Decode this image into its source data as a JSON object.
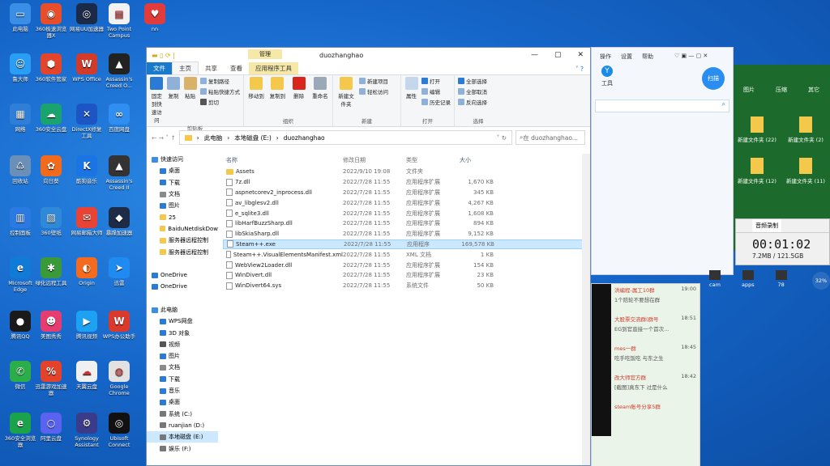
{
  "desktop": {
    "icons": [
      {
        "label": "此电脑",
        "color": "#3a8ee6",
        "glyph": "▭"
      },
      {
        "label": "360极速浏览器X",
        "color": "#e94e2b",
        "glyph": "◉"
      },
      {
        "label": "网易UU加速器",
        "color": "#1c2a4a",
        "glyph": "◎"
      },
      {
        "label": "Two Point Campus",
        "color": "#f2f2f2",
        "glyph": "▤"
      },
      {
        "label": "nn",
        "color": "#e23b3b",
        "glyph": "♥"
      },
      {
        "label": "鲁大师",
        "color": "#2a9df4",
        "glyph": "☺"
      },
      {
        "label": "360软件管家",
        "color": "#e2452b",
        "glyph": "⬢"
      },
      {
        "label": "WPS Office",
        "color": "#d23a2a",
        "glyph": "W"
      },
      {
        "label": "Assassin's Creed O...",
        "color": "#222",
        "glyph": "▲"
      },
      {
        "label": "网络",
        "color": "#2f7fd9",
        "glyph": "▦"
      },
      {
        "label": "360安全云盘",
        "color": "#1aa36f",
        "glyph": "☁"
      },
      {
        "label": "DirectX修复工具",
        "color": "#1d56c4",
        "glyph": "✕"
      },
      {
        "label": "百度网盘",
        "color": "#2f8ef0",
        "glyph": "∞"
      },
      {
        "label": "回收站",
        "color": "#6a8fb8",
        "glyph": "♺"
      },
      {
        "label": "向日葵",
        "color": "#f26a1b",
        "glyph": "✿"
      },
      {
        "label": "酷狗音乐",
        "color": "#1b74e4",
        "glyph": "K"
      },
      {
        "label": "Assassin's Creed II",
        "color": "#333",
        "glyph": "▲"
      },
      {
        "label": "控制面板",
        "color": "#2a7ae2",
        "glyph": "▥"
      },
      {
        "label": "360壁纸",
        "color": "#2f89d6",
        "glyph": "▧"
      },
      {
        "label": "网易邮箱大师",
        "color": "#e94335",
        "glyph": "✉"
      },
      {
        "label": "暴躁加速器",
        "color": "#1e2b46",
        "glyph": "◆"
      },
      {
        "label": "Microsoft Edge",
        "color": "#0f7bd6",
        "glyph": "e"
      },
      {
        "label": "绿化远程工具",
        "color": "#3a9a3a",
        "glyph": "✱"
      },
      {
        "label": "Origin",
        "color": "#f56b1d",
        "glyph": "◐"
      },
      {
        "label": "迅雷",
        "color": "#1f8af0",
        "glyph": "➤"
      },
      {
        "label": "腾讯QQ",
        "color": "#1a1a1a",
        "glyph": "●"
      },
      {
        "label": "美图秀秀",
        "color": "#e63d70",
        "glyph": "☻"
      },
      {
        "label": "腾讯视频",
        "color": "#1da1f2",
        "glyph": "▶"
      },
      {
        "label": "WPS办公助手",
        "color": "#d93a2b",
        "glyph": "W"
      },
      {
        "label": "微信",
        "color": "#2bae49",
        "glyph": "✆"
      },
      {
        "label": "迅雷游戏加速器",
        "color": "#e4432b",
        "glyph": "%"
      },
      {
        "label": "天翼云盘",
        "color": "#f0f0f0",
        "glyph": "☁"
      },
      {
        "label": "Google Chrome",
        "color": "#e2e2e2",
        "glyph": "◍"
      },
      {
        "label": "360安全浏览器",
        "color": "#1aa34a",
        "glyph": "e"
      },
      {
        "label": "阿里云盘",
        "color": "#5a63f0",
        "glyph": "○"
      },
      {
        "label": "Synology Assistant",
        "color": "#3b3b8c",
        "glyph": "⚙"
      },
      {
        "label": "Ubisoft Connect",
        "color": "#111",
        "glyph": "◎"
      }
    ]
  },
  "explorer": {
    "title": "duozhanghao",
    "manage_tab": "管理",
    "tabs": [
      "文件",
      "主页",
      "共享",
      "查看",
      "应用程序工具"
    ],
    "ribbon": {
      "pin": "固定到快速访问",
      "copy": "复制",
      "paste": "粘贴",
      "copy_path": "复制路径",
      "paste_shortcut": "粘贴快捷方式",
      "cut": "剪切",
      "clipboard": "剪贴板",
      "move_to": "移动到",
      "copy_to": "复制到",
      "delete": "删除",
      "rename": "重命名",
      "organize": "组织",
      "new_folder": "新建文件夹",
      "new_item": "新建项目",
      "easy_access": "轻松访问",
      "new": "新建",
      "properties": "属性",
      "open": "打开",
      "edit": "编辑",
      "history": "历史记录",
      "open_group": "打开",
      "select_all": "全部选择",
      "select_none": "全部取消",
      "invert": "反向选择",
      "select": "选择"
    },
    "address": [
      "此电脑",
      "本地磁盘 (E:)",
      "duozhanghao"
    ],
    "search_placeholder": "在 duozhanghao...",
    "nav": [
      {
        "label": "快速访问",
        "color": "#3a8ee6"
      },
      {
        "label": "桌面",
        "color": "#2b7bd6"
      },
      {
        "label": "下载",
        "color": "#2b7bd6"
      },
      {
        "label": "文档",
        "color": "#8a8a8a"
      },
      {
        "label": "图片",
        "color": "#2b7bd6"
      },
      {
        "label": "25",
        "color": "#f3c84b"
      },
      {
        "label": "BaiduNetdiskDow",
        "color": "#f3c84b"
      },
      {
        "label": "服务器远程控制",
        "color": "#f3c84b"
      },
      {
        "label": "服务器远程控制",
        "color": "#f3c84b"
      },
      {
        "label": "",
        "color": "transparent"
      },
      {
        "label": "OneDrive",
        "color": "#2b7bd6"
      },
      {
        "label": "OneDrive",
        "color": "#2b7bd6"
      },
      {
        "label": "",
        "color": "transparent"
      },
      {
        "label": "此电脑",
        "color": "#3a8ee6"
      },
      {
        "label": "WPS网盘",
        "color": "#2b7bd6"
      },
      {
        "label": "3D 对象",
        "color": "#2b7bd6"
      },
      {
        "label": "视频",
        "color": "#555"
      },
      {
        "label": "图片",
        "color": "#2b7bd6"
      },
      {
        "label": "文档",
        "color": "#8a8a8a"
      },
      {
        "label": "下载",
        "color": "#2b7bd6"
      },
      {
        "label": "音乐",
        "color": "#2b7bd6"
      },
      {
        "label": "桌面",
        "color": "#2b7bd6"
      },
      {
        "label": "系统 (C:)",
        "color": "#777"
      },
      {
        "label": "ruanjian (D:)",
        "color": "#777"
      },
      {
        "label": "本地磁盘 (E:)",
        "color": "#777"
      },
      {
        "label": "娱乐 (F:)",
        "color": "#777"
      },
      {
        "label": "",
        "color": "transparent"
      },
      {
        "label": "网络",
        "color": "#3a8ee6"
      }
    ],
    "columns": [
      "名称",
      "修改日期",
      "类型",
      "大小"
    ],
    "files": [
      {
        "name": "Assets",
        "date": "2022/9/10 19:08",
        "type": "文件夹",
        "size": "",
        "folder": true
      },
      {
        "name": "7z.dll",
        "date": "2022/7/28 11:55",
        "type": "应用程序扩展",
        "size": "1,670 KB"
      },
      {
        "name": "aspnetcorev2_inprocess.dll",
        "date": "2022/7/28 11:55",
        "type": "应用程序扩展",
        "size": "345 KB"
      },
      {
        "name": "av_libglesv2.dll",
        "date": "2022/7/28 11:55",
        "type": "应用程序扩展",
        "size": "4,267 KB"
      },
      {
        "name": "e_sqlite3.dll",
        "date": "2022/7/28 11:55",
        "type": "应用程序扩展",
        "size": "1,608 KB"
      },
      {
        "name": "libHarfBuzzSharp.dll",
        "date": "2022/7/28 11:55",
        "type": "应用程序扩展",
        "size": "894 KB"
      },
      {
        "name": "libSkiaSharp.dll",
        "date": "2022/7/28 11:55",
        "type": "应用程序扩展",
        "size": "9,152 KB"
      },
      {
        "name": "Steam++.exe",
        "date": "2022/7/28 11:55",
        "type": "应用程序",
        "size": "169,578 KB",
        "sel": true
      },
      {
        "name": "Steam++.VisualElementsManifest.xml",
        "date": "2022/7/28 11:55",
        "type": "XML 文档",
        "size": "1 KB"
      },
      {
        "name": "WebView2Loader.dll",
        "date": "2022/7/28 11:55",
        "type": "应用程序扩展",
        "size": "154 KB"
      },
      {
        "name": "WinDivert.dll",
        "date": "2022/7/28 11:55",
        "type": "应用程序扩展",
        "size": "23 KB"
      },
      {
        "name": "WinDivert64.sys",
        "date": "2022/7/28 11:55",
        "type": "系统文件",
        "size": "50 KB"
      }
    ]
  },
  "right": {
    "menu": [
      "操作",
      "设置",
      "帮助"
    ],
    "tool_label": "工具",
    "scan_label": "扫描",
    "fm_cols": [
      "图片",
      "压缩",
      "其它"
    ],
    "folders": [
      {
        "label": "新建文件夹 (22)"
      },
      {
        "label": "新建文件夹 (2)"
      },
      {
        "label": "新建文件夹 (12)"
      },
      {
        "label": "新建文件夹 (11)"
      }
    ],
    "rec_tabs": [
      "音频录制"
    ],
    "timer": "00:01:02",
    "rec_size": "7.2MB / 121.5GB",
    "bottom_icons": [
      "cam",
      "apps",
      "78"
    ],
    "pct": "32%",
    "chats": [
      {
        "title": "洪编程-属工10群",
        "time": "19:00",
        "msg": "1个陪轮不要想在群"
      },
      {
        "title": "大股票交流群(群号",
        "time": "18:51",
        "msg": "EG到官直接一个首次..."
      },
      {
        "title": "mes一群",
        "time": "18:45",
        "msg": "吃手吃饭吃 与东之生 "
      },
      {
        "title": "改大师官方群",
        "time": "18:42",
        "msg": "[截图]真东下 过是什么"
      },
      {
        "title": "steam账号分享5群",
        "time": "",
        "msg": ""
      }
    ]
  }
}
